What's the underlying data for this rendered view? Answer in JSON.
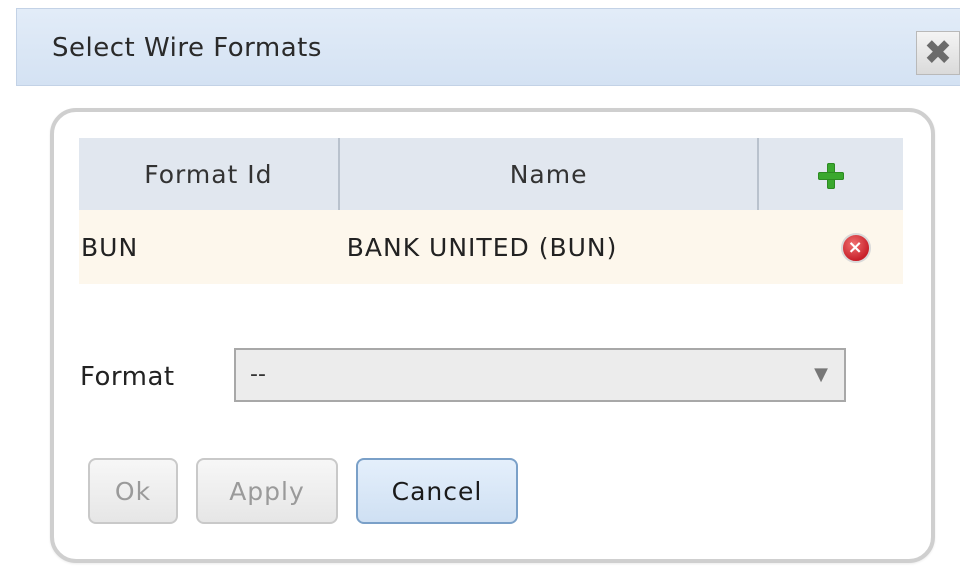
{
  "dialog": {
    "title": "Select Wire Formats",
    "close_symbol": "✖"
  },
  "grid": {
    "headers": {
      "format_id": "Format Id",
      "name": "Name",
      "add_icon": "plus-icon"
    },
    "rows": [
      {
        "format_id": "BUN",
        "name": "BANK UNITED (BUN)",
        "action_icon": "delete-icon"
      }
    ]
  },
  "form": {
    "format_label": "Format",
    "format_value": "--"
  },
  "buttons": {
    "ok": "Ok",
    "apply": "Apply",
    "cancel": "Cancel"
  },
  "colors": {
    "title_bar": "#d4e2f3",
    "header_row": "#e1e7ef",
    "data_row": "#fdf7ec",
    "add_icon": "#3aa82e",
    "delete_icon": "#c8202a",
    "cancel_button": "#cfe0f3"
  }
}
